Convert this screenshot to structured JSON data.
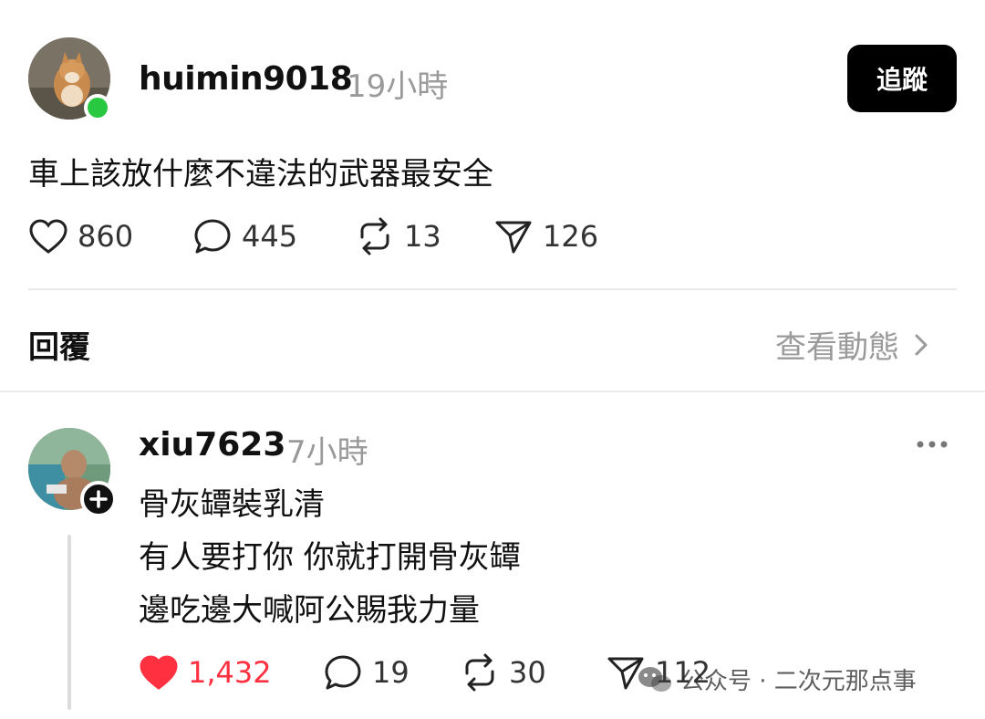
{
  "post": {
    "username": "huimin9018",
    "time": "19小時",
    "follow_label": "追蹤",
    "text": "車上該放什麼不違法的武器最安全",
    "stats": {
      "likes": "860",
      "comments": "445",
      "reposts": "13",
      "shares": "126"
    }
  },
  "replies_header": {
    "label": "回覆",
    "view_activity": "查看動態"
  },
  "reply": {
    "username": "xiu7623",
    "time": "7小時",
    "lines": [
      "骨灰罈裝乳清",
      "有人要打你 你就打開骨灰罈",
      "邊吃邊大喊阿公賜我力量"
    ],
    "stats": {
      "likes": "1,432",
      "comments": "19",
      "reposts": "30",
      "shares": "112"
    },
    "liked": true
  },
  "watermark": {
    "text": "公众号 · 二次元那点事"
  },
  "colors": {
    "like_red": "#ff3040",
    "online_green": "#28c840",
    "muted": "#9a9a9a"
  },
  "icons": [
    "heart-icon",
    "comment-icon",
    "repost-icon",
    "share-icon",
    "chevron-right-icon",
    "more-icon",
    "plus-icon",
    "wechat-icon"
  ]
}
